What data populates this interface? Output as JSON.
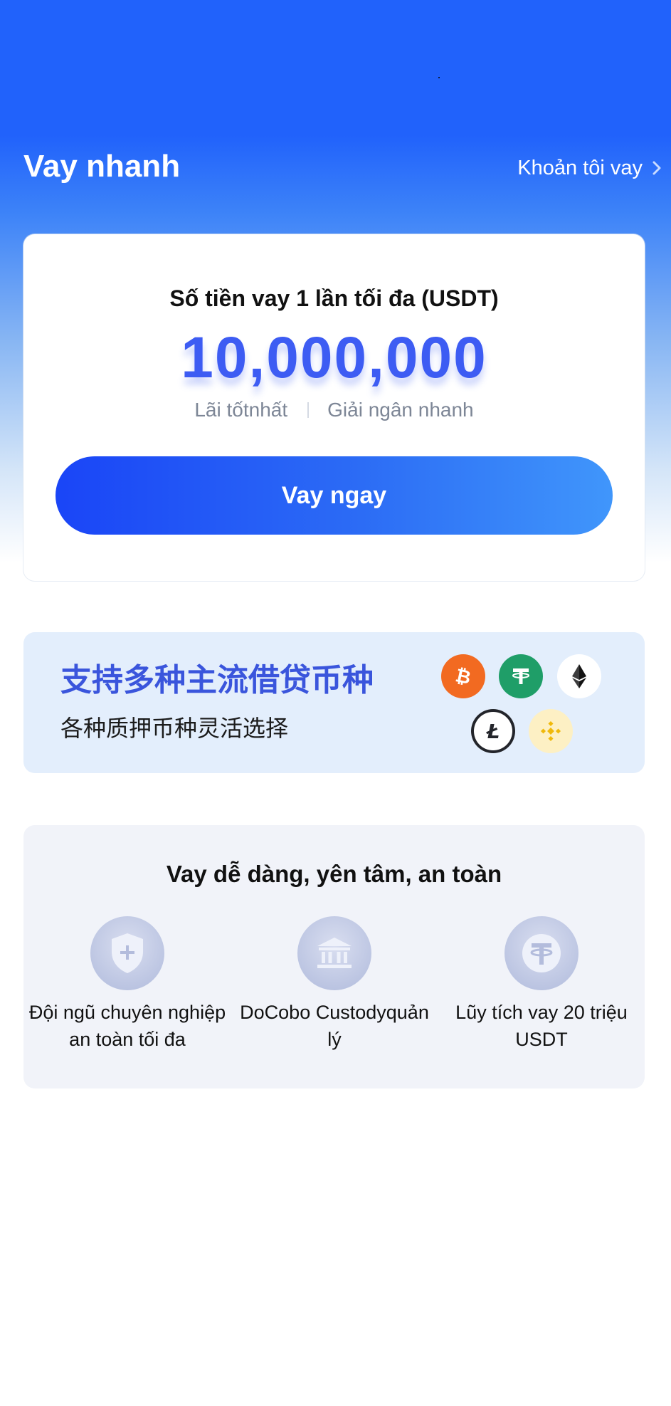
{
  "header": {
    "title": "Vay nhanh",
    "my_loans_link": "Khoản tôi vay",
    "my_loans_icon": "chevron-right-icon"
  },
  "loan_card": {
    "heading": "Số tiền vay 1 lần tối đa (USDT)",
    "max_amount": "10,000,000",
    "feature_1": "Lãi tốtnhất",
    "feature_2": "Giải ngân nhanh",
    "borrow_button": "Vay ngay"
  },
  "coins_banner": {
    "title": "支持多种主流借贷币种",
    "subtitle": "各种质押币种灵活选择",
    "coins": [
      "bitcoin-icon",
      "tether-icon",
      "ethereum-icon",
      "litecoin-icon",
      "binance-coin-icon"
    ]
  },
  "features_panel": {
    "title": "Vay dễ dàng, yên tâm, an toàn",
    "items": [
      {
        "icon": "shield-icon",
        "label_line_1": "Đội ngũ chuyên nghiệp",
        "label_line_2": "an toàn tối đa"
      },
      {
        "icon": "bank-icon",
        "label_line_1": "DoCobo Custodyquản",
        "label_line_2": "lý"
      },
      {
        "icon": "tether-icon",
        "label_line_1": "Lũy tích vay 20 triệu",
        "label_line_2": "USDT"
      }
    ]
  },
  "colors": {
    "primary": "#2162fb",
    "amount": "#3d5cf3",
    "banner_title": "#3a55dc",
    "bitcoin": "#f26a21",
    "tether": "#1f9e68",
    "binance": "#f0b90b"
  }
}
